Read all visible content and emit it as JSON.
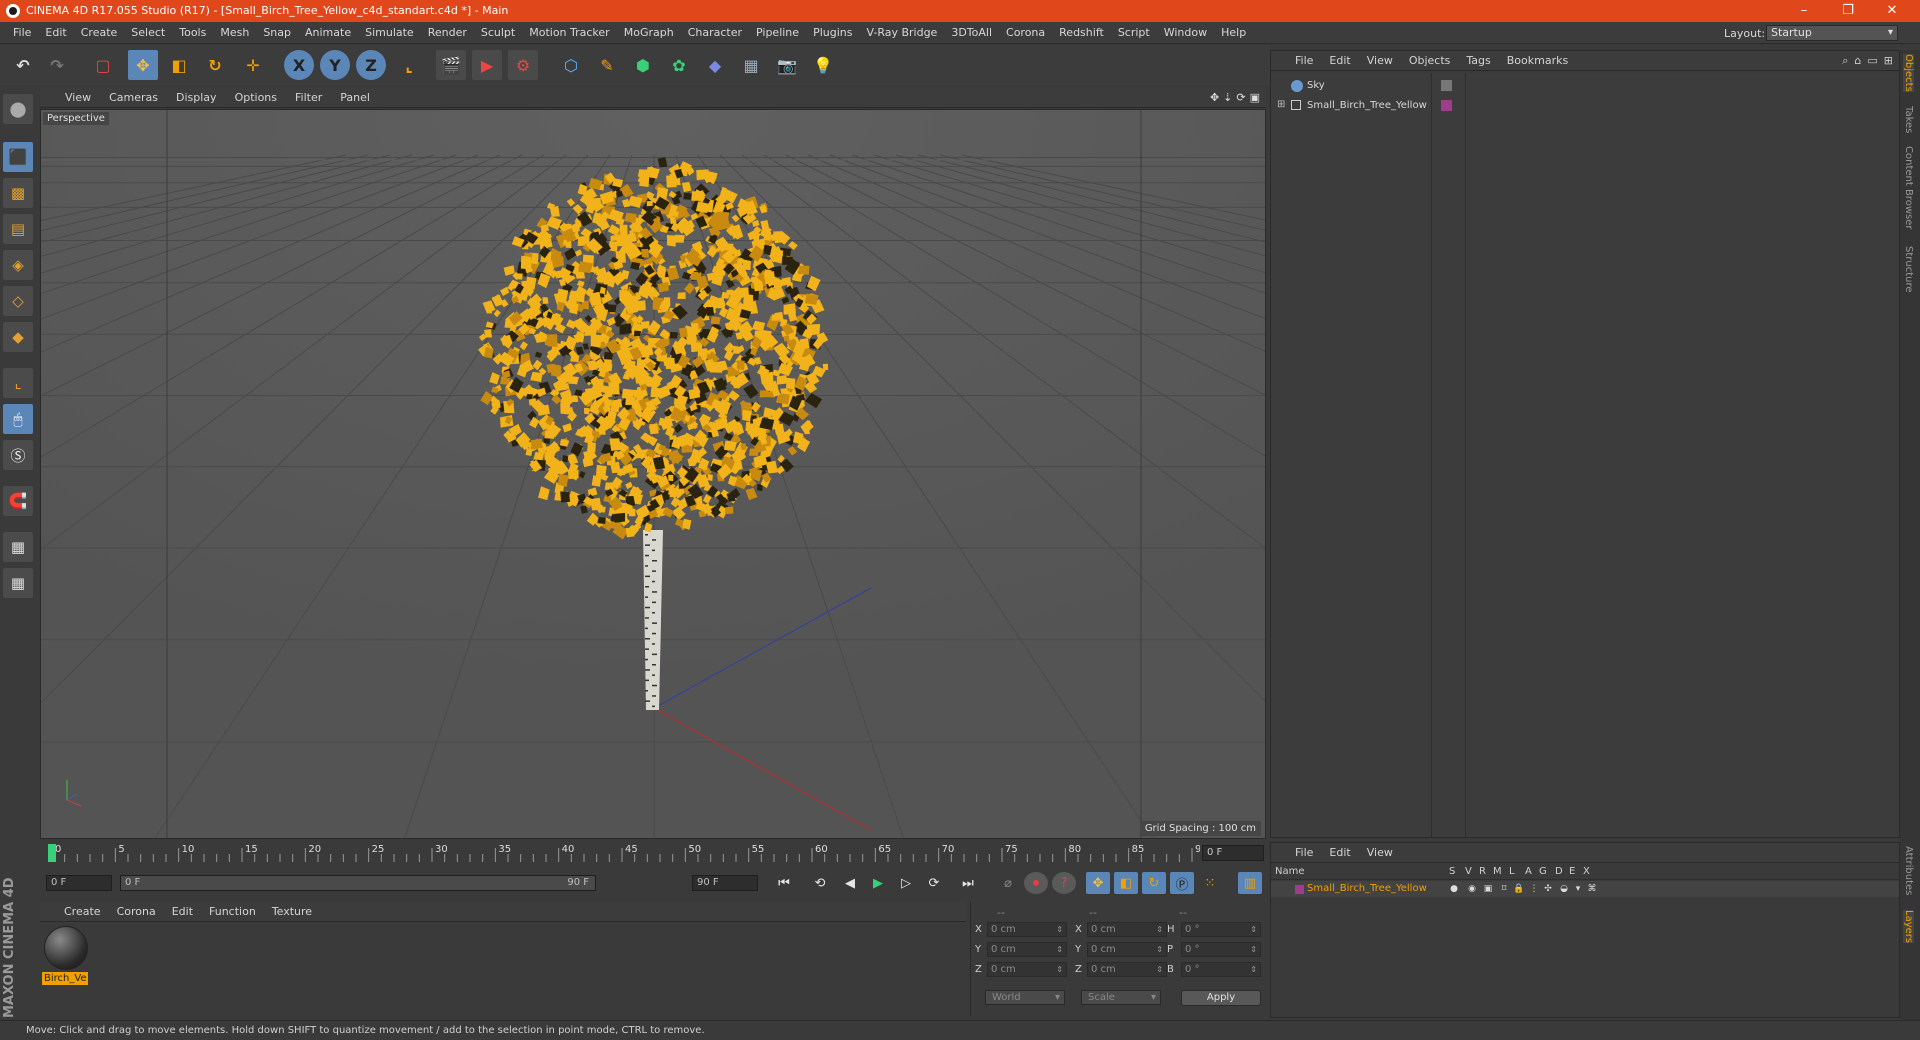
{
  "window": {
    "title": "CINEMA 4D R17.055 Studio (R17) - [Small_Birch_Tree_Yellow_c4d_standart.c4d *] - Main",
    "controls": [
      "–",
      "❐",
      "✕"
    ]
  },
  "menubar": {
    "items": [
      "File",
      "Edit",
      "Create",
      "Select",
      "Tools",
      "Mesh",
      "Snap",
      "Animate",
      "Simulate",
      "Render",
      "Sculpt",
      "Motion Tracker",
      "MoGraph",
      "Character",
      "Pipeline",
      "Plugins",
      "V-Ray Bridge",
      "3DToAll",
      "Corona",
      "Redshift",
      "Script",
      "Window",
      "Help"
    ],
    "layout_label": "Layout:",
    "layout_value": "Startup"
  },
  "toolbar": {
    "axis_x": "X",
    "axis_y": "Y",
    "axis_z": "Z"
  },
  "viewport": {
    "menu": [
      "View",
      "Cameras",
      "Display",
      "Options",
      "Filter",
      "Panel"
    ],
    "label": "Perspective",
    "grid_spacing": "Grid Spacing : 100 cm",
    "background_color": "#545454",
    "foliage_color": "#f2b21a"
  },
  "timeline": {
    "ticks": [
      "0",
      "5",
      "10",
      "15",
      "20",
      "25",
      "30",
      "35",
      "40",
      "45",
      "50",
      "55",
      "60",
      "65",
      "70",
      "75",
      "80",
      "85",
      "90"
    ],
    "current_frame": "0 F",
    "start_field": "0 F",
    "range_start": "0 F",
    "range_end": "90 F",
    "end_field": "90 F"
  },
  "material_manager": {
    "menu": [
      "Create",
      "Corona",
      "Edit",
      "Function",
      "Texture"
    ],
    "material_name": "Birch_Ve"
  },
  "coordinates": {
    "headers": [
      "--",
      "--",
      "--"
    ],
    "rows": [
      {
        "a": "X",
        "av": "0 cm",
        "b": "X",
        "bv": "0 cm",
        "c": "H",
        "cv": "0 °"
      },
      {
        "a": "Y",
        "av": "0 cm",
        "b": "Y",
        "bv": "0 cm",
        "c": "P",
        "cv": "0 °"
      },
      {
        "a": "Z",
        "av": "0 cm",
        "b": "Z",
        "bv": "0 cm",
        "c": "B",
        "cv": "0 °"
      }
    ],
    "mode": "World",
    "scale": "Scale",
    "apply": "Apply"
  },
  "object_manager": {
    "menu": [
      "File",
      "Edit",
      "View",
      "Objects",
      "Tags",
      "Bookmarks"
    ],
    "objects": [
      {
        "name": "Sky",
        "icon": "sky-icon"
      },
      {
        "name": "Small_Birch_Tree_Yellow",
        "icon": "null-icon"
      }
    ]
  },
  "layer_manager": {
    "menu": [
      "File",
      "Edit",
      "View"
    ],
    "columns": [
      "Name",
      "S",
      "V",
      "R",
      "M",
      "L",
      "A",
      "G",
      "D",
      "E",
      "X"
    ],
    "layer_name": "Small_Birch_Tree_Yellow",
    "layer_color": "#a03c8c"
  },
  "right_tabs": [
    "Objects",
    "Takes",
    "Content Browser",
    "Structure",
    "Attributes",
    "Layers"
  ],
  "status": "Move: Click and drag to move elements. Hold down SHIFT to quantize movement / add to the selection in point mode, CTRL to remove.",
  "branding": "MAXON CINEMA 4D"
}
